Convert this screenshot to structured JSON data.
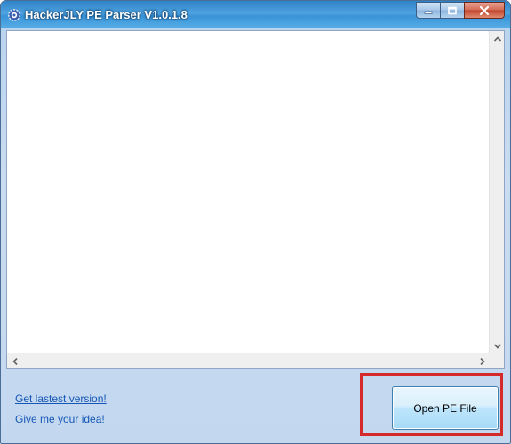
{
  "window": {
    "title": "HackerJLY PE Parser V1.0.1.8",
    "icon": "gear-app-icon",
    "controls": [
      "minimize-icon",
      "maximize-icon",
      "close-icon"
    ]
  },
  "output_area": {
    "text": ""
  },
  "links": {
    "latest_version": "Get lastest version!",
    "give_idea": "Give me your idea!"
  },
  "actions": {
    "open_pe_file": "Open PE File"
  },
  "colors": {
    "highlight_border": "#d62a2a",
    "link": "#1556b6",
    "titlebar": "#3a93d6"
  }
}
